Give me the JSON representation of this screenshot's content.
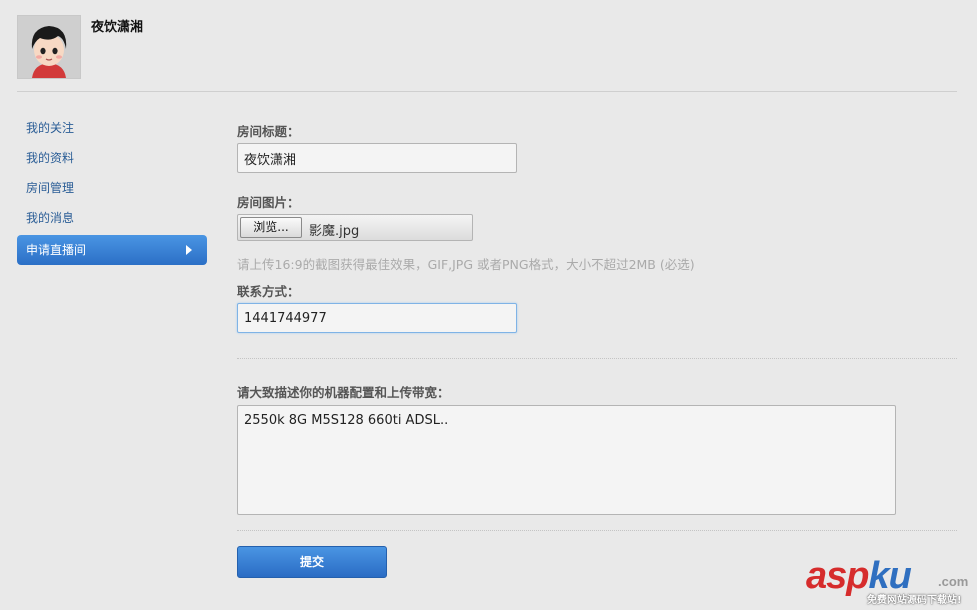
{
  "profile": {
    "username": "夜饮潇湘"
  },
  "sidebar": {
    "items": [
      {
        "label": "我的关注"
      },
      {
        "label": "我的资料"
      },
      {
        "label": "房间管理"
      },
      {
        "label": "我的消息"
      },
      {
        "label": "申请直播间",
        "active": true
      }
    ]
  },
  "form": {
    "room_title_label": "房间标题：",
    "room_title_value": "夜饮潇湘",
    "room_image_label": "房间图片：",
    "browse_label": "浏览...",
    "file_name": "影魔.jpg",
    "image_hint": "请上传16:9的截图获得最佳效果，GIF,JPG 或者PNG格式，大小不超过2MB (必选)",
    "contact_label": "联系方式：",
    "contact_value": "1441744977",
    "desc_label": "请大致描述你的机器配置和上传带宽：",
    "desc_value": "2550k 8G M5S128 660ti ADSL..",
    "submit_label": "提交"
  },
  "watermark": {
    "brand_red": "asp",
    "brand_blue": "ku",
    "suffix": ".com",
    "sub": "免费网站源码下载站!"
  },
  "colors": {
    "accent": "#2b6fc6",
    "link": "#2a5d96",
    "background": "#e9e9e9"
  },
  "icons": {
    "active_arrow": "chevron-right-icon"
  }
}
